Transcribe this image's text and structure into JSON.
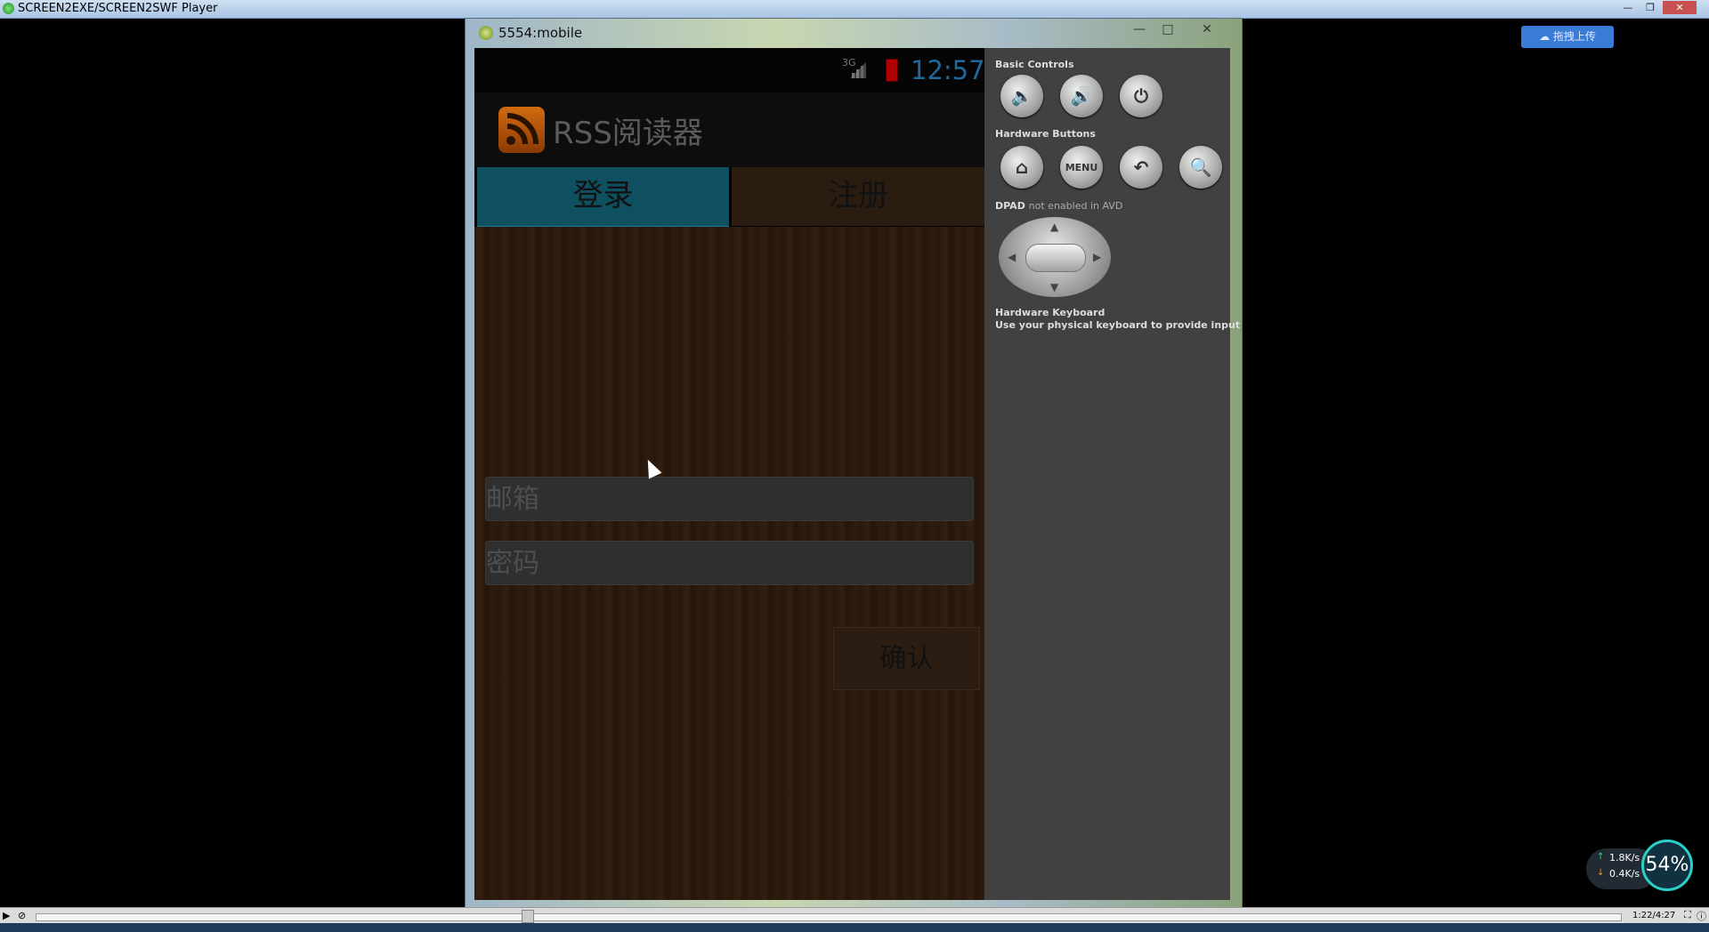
{
  "player": {
    "title": "SCREEN2EXE/SCREEN2SWF Player",
    "time": "1:22/4:27",
    "progress_percent": 31
  },
  "emulator": {
    "title": "5554:mobile",
    "minimize": "—",
    "maximize": "□",
    "close": "✕"
  },
  "status_bar": {
    "network": "3G",
    "clock": "12:57"
  },
  "app": {
    "title": "RSS阅读器",
    "tabs": [
      {
        "label": "登录",
        "selected": true
      },
      {
        "label": "注册",
        "selected": false
      }
    ],
    "email_placeholder": "邮箱",
    "password_placeholder": "密码",
    "confirm_label": "确认"
  },
  "controls": {
    "basic_label": "Basic Controls",
    "hardware_buttons_label": "Hardware Buttons",
    "menu_label": "MENU",
    "dpad_label": "DPAD",
    "dpad_note": "not enabled in AVD",
    "keyboard_title": "Hardware Keyboard",
    "keyboard_desc": "Use your physical keyboard to provide input"
  },
  "upload_badge": "拖拽上传",
  "network_widget": {
    "up": "1.8K/s",
    "down": "0.4K/s",
    "percent": "54%"
  },
  "colors": {
    "tab_selected": "#0e5060",
    "clock": "#1f6a9a",
    "accent": "#2ad0c7"
  }
}
